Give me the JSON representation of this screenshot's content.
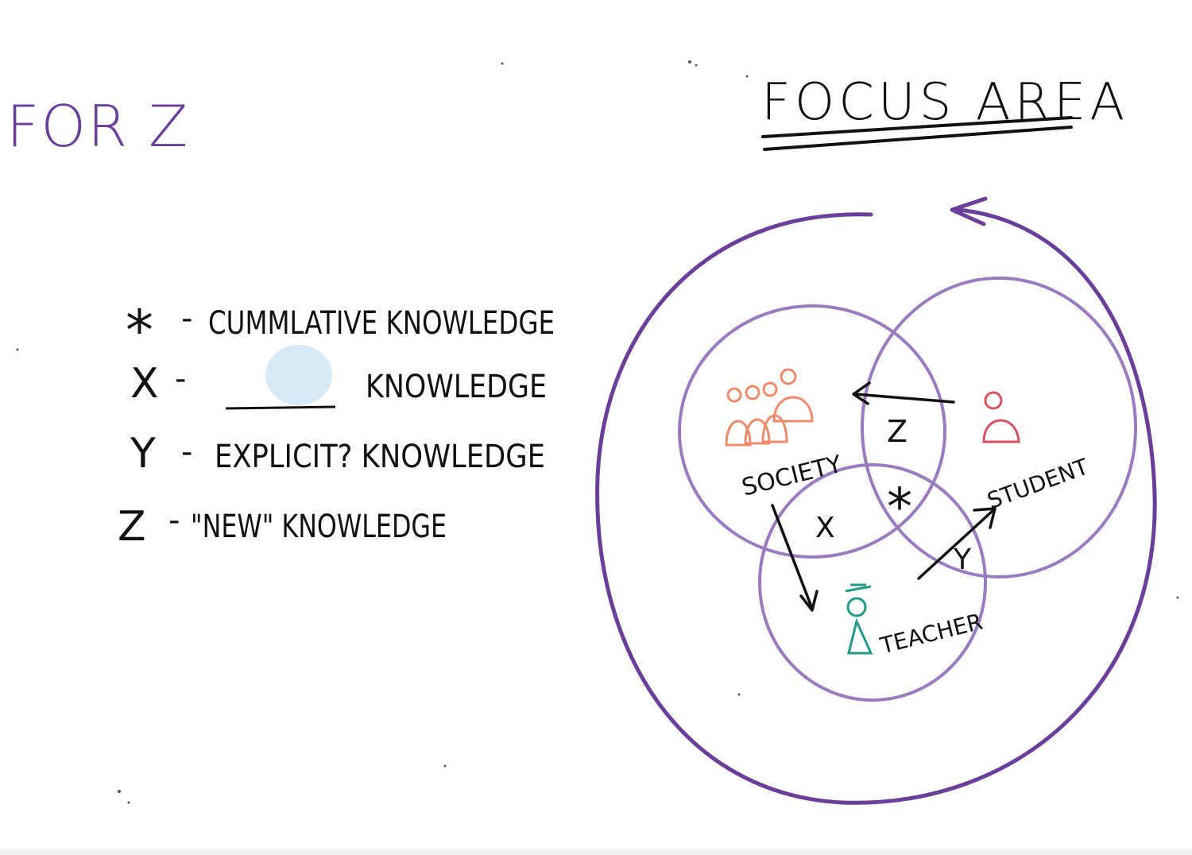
{
  "corner_note": "FOR Z",
  "title": "FOCUS AREA",
  "legend": {
    "star": {
      "symbol": "*",
      "dash": "-",
      "text": "CUMMLATIVE KNOWLEDGE"
    },
    "x": {
      "symbol": "X",
      "dash": "-",
      "text": "KNOWLEDGE"
    },
    "y": {
      "symbol": "Y",
      "dash": "-",
      "text": "EXPLICIT? KNOWLEDGE"
    },
    "z": {
      "symbol": "Z",
      "dash": "-",
      "text": "\"NEW\" KNOWLEDGE"
    }
  },
  "venn": {
    "society": "SOCIETY",
    "student": "STUDENT",
    "teacher": "TEACHER",
    "region_z": "Z",
    "region_star": "*",
    "region_x": "X",
    "region_y": "Y"
  },
  "colors": {
    "ink_black": "#111111",
    "ink_purple": "#6a3f9a",
    "circle_purple": "#9b7bc0",
    "society_orange": "#f08a6a",
    "student_red": "#d8505e",
    "teacher_teal": "#1f9a8a",
    "smudge_blue": "#cfe6f7"
  }
}
